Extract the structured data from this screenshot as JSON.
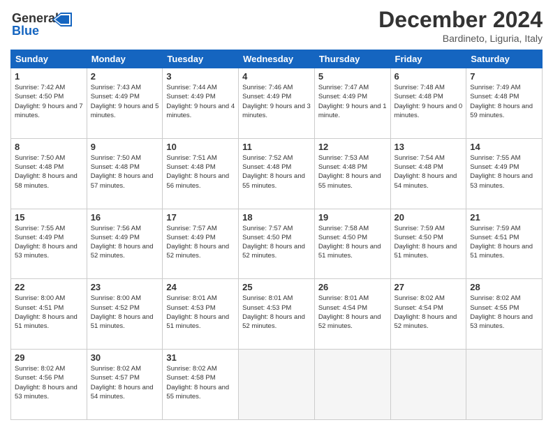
{
  "header": {
    "logo_line1": "General",
    "logo_line2": "Blue",
    "month": "December 2024",
    "location": "Bardineto, Liguria, Italy"
  },
  "weekdays": [
    "Sunday",
    "Monday",
    "Tuesday",
    "Wednesday",
    "Thursday",
    "Friday",
    "Saturday"
  ],
  "weeks": [
    [
      {
        "day": 1,
        "sunrise": "7:42 AM",
        "sunset": "4:50 PM",
        "daylight": "9 hours and 7 minutes."
      },
      {
        "day": 2,
        "sunrise": "7:43 AM",
        "sunset": "4:49 PM",
        "daylight": "9 hours and 5 minutes."
      },
      {
        "day": 3,
        "sunrise": "7:44 AM",
        "sunset": "4:49 PM",
        "daylight": "9 hours and 4 minutes."
      },
      {
        "day": 4,
        "sunrise": "7:46 AM",
        "sunset": "4:49 PM",
        "daylight": "9 hours and 3 minutes."
      },
      {
        "day": 5,
        "sunrise": "7:47 AM",
        "sunset": "4:49 PM",
        "daylight": "9 hours and 1 minute."
      },
      {
        "day": 6,
        "sunrise": "7:48 AM",
        "sunset": "4:48 PM",
        "daylight": "9 hours and 0 minutes."
      },
      {
        "day": 7,
        "sunrise": "7:49 AM",
        "sunset": "4:48 PM",
        "daylight": "8 hours and 59 minutes."
      }
    ],
    [
      {
        "day": 8,
        "sunrise": "7:50 AM",
        "sunset": "4:48 PM",
        "daylight": "8 hours and 58 minutes."
      },
      {
        "day": 9,
        "sunrise": "7:50 AM",
        "sunset": "4:48 PM",
        "daylight": "8 hours and 57 minutes."
      },
      {
        "day": 10,
        "sunrise": "7:51 AM",
        "sunset": "4:48 PM",
        "daylight": "8 hours and 56 minutes."
      },
      {
        "day": 11,
        "sunrise": "7:52 AM",
        "sunset": "4:48 PM",
        "daylight": "8 hours and 55 minutes."
      },
      {
        "day": 12,
        "sunrise": "7:53 AM",
        "sunset": "4:48 PM",
        "daylight": "8 hours and 55 minutes."
      },
      {
        "day": 13,
        "sunrise": "7:54 AM",
        "sunset": "4:48 PM",
        "daylight": "8 hours and 54 minutes."
      },
      {
        "day": 14,
        "sunrise": "7:55 AM",
        "sunset": "4:49 PM",
        "daylight": "8 hours and 53 minutes."
      }
    ],
    [
      {
        "day": 15,
        "sunrise": "7:55 AM",
        "sunset": "4:49 PM",
        "daylight": "8 hours and 53 minutes."
      },
      {
        "day": 16,
        "sunrise": "7:56 AM",
        "sunset": "4:49 PM",
        "daylight": "8 hours and 52 minutes."
      },
      {
        "day": 17,
        "sunrise": "7:57 AM",
        "sunset": "4:49 PM",
        "daylight": "8 hours and 52 minutes."
      },
      {
        "day": 18,
        "sunrise": "7:57 AM",
        "sunset": "4:50 PM",
        "daylight": "8 hours and 52 minutes."
      },
      {
        "day": 19,
        "sunrise": "7:58 AM",
        "sunset": "4:50 PM",
        "daylight": "8 hours and 51 minutes."
      },
      {
        "day": 20,
        "sunrise": "7:59 AM",
        "sunset": "4:50 PM",
        "daylight": "8 hours and 51 minutes."
      },
      {
        "day": 21,
        "sunrise": "7:59 AM",
        "sunset": "4:51 PM",
        "daylight": "8 hours and 51 minutes."
      }
    ],
    [
      {
        "day": 22,
        "sunrise": "8:00 AM",
        "sunset": "4:51 PM",
        "daylight": "8 hours and 51 minutes."
      },
      {
        "day": 23,
        "sunrise": "8:00 AM",
        "sunset": "4:52 PM",
        "daylight": "8 hours and 51 minutes."
      },
      {
        "day": 24,
        "sunrise": "8:01 AM",
        "sunset": "4:53 PM",
        "daylight": "8 hours and 51 minutes."
      },
      {
        "day": 25,
        "sunrise": "8:01 AM",
        "sunset": "4:53 PM",
        "daylight": "8 hours and 52 minutes."
      },
      {
        "day": 26,
        "sunrise": "8:01 AM",
        "sunset": "4:54 PM",
        "daylight": "8 hours and 52 minutes."
      },
      {
        "day": 27,
        "sunrise": "8:02 AM",
        "sunset": "4:54 PM",
        "daylight": "8 hours and 52 minutes."
      },
      {
        "day": 28,
        "sunrise": "8:02 AM",
        "sunset": "4:55 PM",
        "daylight": "8 hours and 53 minutes."
      }
    ],
    [
      {
        "day": 29,
        "sunrise": "8:02 AM",
        "sunset": "4:56 PM",
        "daylight": "8 hours and 53 minutes."
      },
      {
        "day": 30,
        "sunrise": "8:02 AM",
        "sunset": "4:57 PM",
        "daylight": "8 hours and 54 minutes."
      },
      {
        "day": 31,
        "sunrise": "8:02 AM",
        "sunset": "4:58 PM",
        "daylight": "8 hours and 55 minutes."
      },
      null,
      null,
      null,
      null
    ]
  ]
}
